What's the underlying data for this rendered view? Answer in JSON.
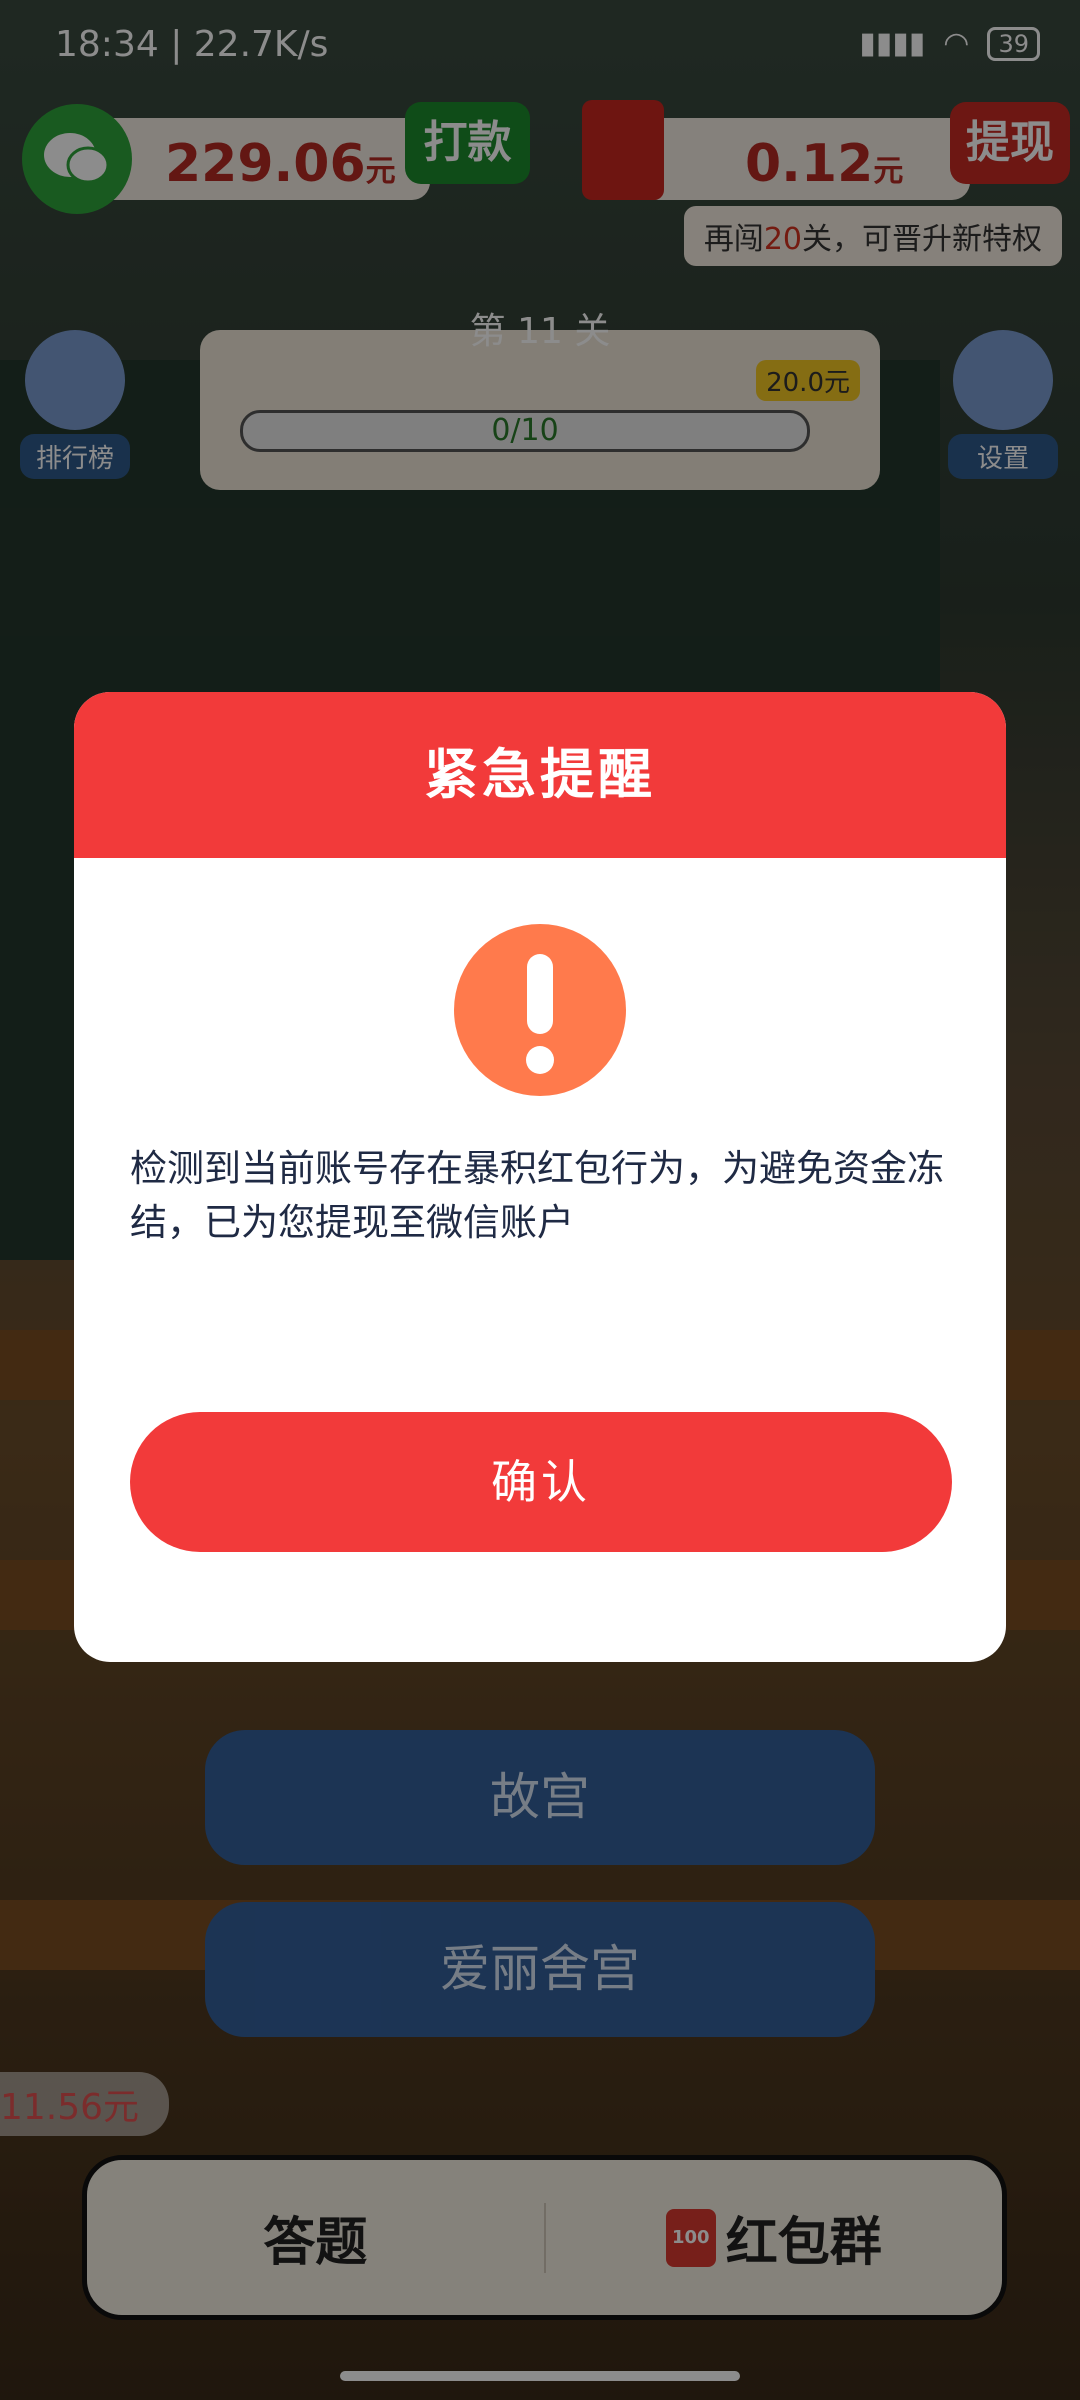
{
  "status_bar": {
    "time": "18:34 | 22.7K/s",
    "battery": "39"
  },
  "top_bar": {
    "wechat_balance": "229.06",
    "wechat_unit": "元",
    "pay_button": "打款",
    "redpacket_balance": "0.12",
    "redpacket_unit": "元",
    "withdraw_button": "提现"
  },
  "tip": {
    "prefix": "再闯",
    "highlight": "20",
    "suffix": "关，可晋升新特权"
  },
  "level": {
    "title": "第 11 关",
    "progress": "0/10",
    "reward": "20.0元"
  },
  "side_buttons": {
    "leaderboard": "排行榜",
    "settings": "设置"
  },
  "answers": [
    "故宫",
    "爱丽舍宫"
  ],
  "side_amount": "11.56元",
  "bottom_nav": {
    "answer_tab": "答题",
    "redpacket_group_tab": "红包群",
    "badge": "100"
  },
  "modal": {
    "title": "紧急提醒",
    "message": "检测到当前账号存在暴积红包行为，为避免资金冻结，已为您提现至微信账户",
    "confirm": "确认"
  },
  "colors": {
    "modal_red": "#f23a3a",
    "alert_orange": "#ff7a4c",
    "text_navy": "#1f2a44"
  }
}
